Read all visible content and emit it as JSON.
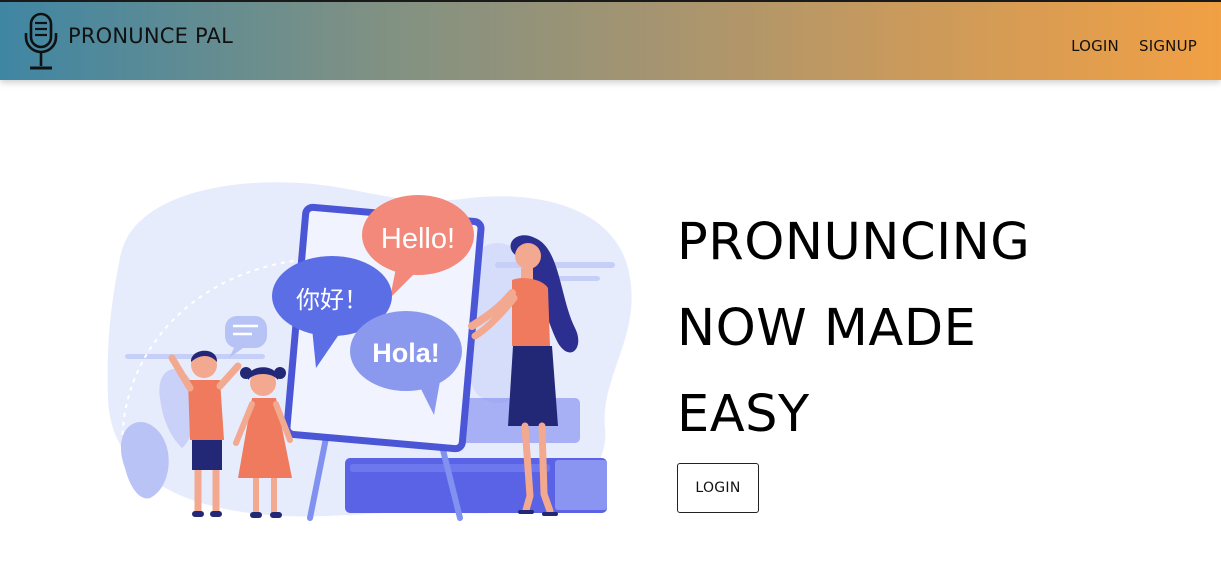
{
  "navbar": {
    "brand": "PRONUNCE PAL",
    "links": [
      {
        "label": "LOGIN"
      },
      {
        "label": "SIGNUP"
      }
    ]
  },
  "hero": {
    "headline_lines": [
      "PRONUNCING",
      "NOW MADE",
      "EASY"
    ],
    "login_button": "LOGIN",
    "speech_bubbles": {
      "hello": "Hello!",
      "nihao": "你好！",
      "hola": "Hola!"
    }
  },
  "colors": {
    "gradient_start": "#3f86a3",
    "gradient_end": "#f1a044",
    "bubble_salmon": "#f2897a",
    "bubble_blue": "#5b6ee6",
    "bubble_lavender": "#8a99ee"
  },
  "icons": {
    "brand": "microphone-icon"
  }
}
